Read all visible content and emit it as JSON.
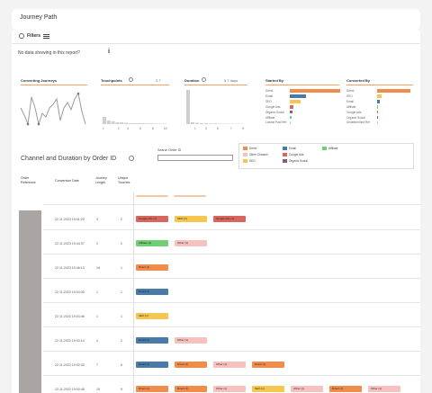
{
  "header": {
    "title": "Journey Path"
  },
  "filters": {
    "label": "Filters"
  },
  "nodata": {
    "text": "No data showing in this report?"
  },
  "panels": {
    "converting": {
      "title": "Converting Journeys"
    },
    "touchpoints": {
      "title": "Touchpoints",
      "value": "2.7"
    },
    "duration": {
      "title": "Duration",
      "value": "5.7 days"
    },
    "started": {
      "title": "Started By"
    },
    "converted": {
      "title": "Converted By"
    }
  },
  "touchpoints_axis": [
    "1",
    "2",
    "4",
    "6",
    "8",
    "10"
  ],
  "duration_axis": [
    "1",
    "3",
    "5",
    "7",
    "9"
  ],
  "started_by": {
    "channels": [
      "Direct",
      "Email",
      "SEO",
      "Google Ads",
      "Organic Social",
      "Affiliate",
      "Lowest Paid Ref"
    ],
    "values": [
      100,
      32,
      22,
      7,
      5,
      3,
      2
    ],
    "colors": [
      "#f28c4b",
      "#4a7aa8",
      "#f5c74f",
      "#d8665d",
      "#8b5a78",
      "#6fcf73",
      "#cfcfcf"
    ]
  },
  "converted_by": {
    "channels": [
      "Direct",
      "SEO",
      "Email",
      "Affiliate",
      "Google Ads",
      "Organic Social",
      "Undetermined Ref"
    ],
    "values": [
      100,
      14,
      8,
      4,
      2,
      2,
      1
    ],
    "colors": [
      "#f28c4b",
      "#f5c74f",
      "#4a7aa8",
      "#6fcf73",
      "#d8665d",
      "#8b5a78",
      "#cfcfcf"
    ]
  },
  "main": {
    "title": "Channel and Duration by Order ID",
    "search_label": "Search Order ID",
    "search_placeholder": ""
  },
  "legend": [
    {
      "label": "Direct",
      "color": "#f28c4b"
    },
    {
      "label": "Other Channel",
      "color": "#f7c2bd"
    },
    {
      "label": "SEO",
      "color": "#f5c74f"
    },
    {
      "label": "Email",
      "color": "#4a7aa8"
    },
    {
      "label": "Google Ads",
      "color": "#d8665d"
    },
    {
      "label": "Organic Social",
      "color": "#8b5a78"
    },
    {
      "label": "Affiliate",
      "color": "#6fcf73"
    }
  ],
  "columns": {
    "order": "Order\nReference",
    "date": "Conversion Date",
    "length": "Journey\nLength",
    "touches": "Unique\nTouches"
  },
  "rows": [
    {
      "date": "22.11.2023 19:01:20",
      "length": "3",
      "touches": "2"
    },
    {
      "date": "22.11.2023 19:44:37",
      "length": "2",
      "touches": "2"
    },
    {
      "date": "22.11.2023 19:46:13",
      "length": "16",
      "touches": "1"
    },
    {
      "date": "22.11.2023 19:04:30",
      "length": "1",
      "touches": "1"
    },
    {
      "date": "22.11.2023 19:03:46",
      "length": "1",
      "touches": "1"
    },
    {
      "date": "22.11.2023 19:03:14",
      "length": "4",
      "touches": "2"
    },
    {
      "date": "22.11.2023 19:02:30",
      "length": "7",
      "touches": "6"
    },
    {
      "date": "22.11.2023 19:00:48",
      "length": "19",
      "touches": "9"
    }
  ],
  "chips": [
    [
      {
        "label": "Google Ads (1)",
        "color": "#d8665d"
      },
      {
        "label": "SEO (1)",
        "color": "#f5c74f"
      },
      {
        "label": "Google Ads (1)",
        "color": "#d8665d"
      }
    ],
    [
      {
        "label": "Affiliate (1)",
        "color": "#6fcf73"
      },
      {
        "label": "Other (1)",
        "color": "#f7c2bd"
      }
    ],
    [
      {
        "label": "Direct (1)",
        "color": "#f28c4b"
      }
    ],
    [
      {
        "label": "Email (1)",
        "color": "#4a7aa8"
      }
    ],
    [
      {
        "label": "SEO (1)",
        "color": "#f5c74f"
      }
    ],
    [
      {
        "label": "Email (1)",
        "color": "#4a7aa8"
      },
      {
        "label": "Other (1)",
        "color": "#f7c2bd"
      }
    ],
    [
      {
        "label": "Email (1)",
        "color": "#4a7aa8"
      },
      {
        "label": "Direct (1)",
        "color": "#f28c4b"
      },
      {
        "label": "Other (1)",
        "color": "#f7c2bd"
      },
      {
        "label": "Direct (1)",
        "color": "#f28c4b"
      }
    ],
    [
      {
        "label": "Direct (1)",
        "color": "#f28c4b"
      },
      {
        "label": "Direct (1)",
        "color": "#f28c4b"
      },
      {
        "label": "Other (1)",
        "color": "#f7c2bd"
      },
      {
        "label": "SEO (1)",
        "color": "#f5c74f"
      },
      {
        "label": "Other (1)",
        "color": "#f7c2bd"
      },
      {
        "label": "Direct (1)",
        "color": "#f28c4b"
      },
      {
        "label": "Other (1)",
        "color": "#f7c2bd"
      }
    ]
  ]
}
